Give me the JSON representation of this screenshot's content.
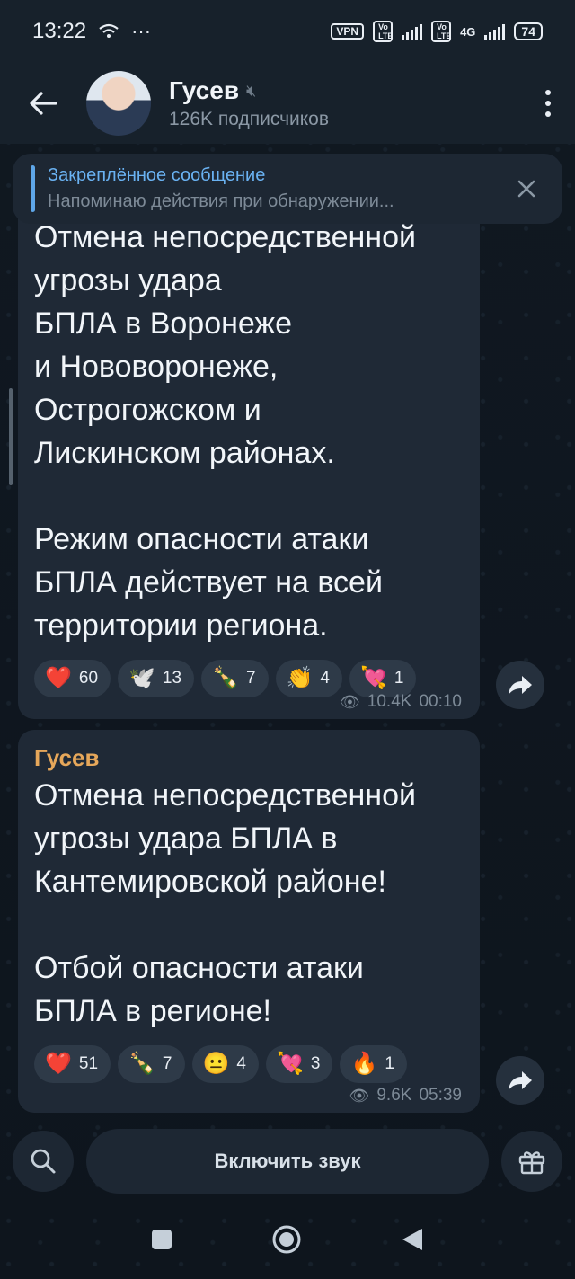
{
  "status": {
    "time": "13:22",
    "vpn": "VPN",
    "volte1": "Vo LTE",
    "volte2": "Vo LTE",
    "net": "4G",
    "battery": "74"
  },
  "header": {
    "title": "Гусев",
    "subtitle": "126K подписчиков"
  },
  "pinned": {
    "title": "Закреплённое сообщение",
    "body": "Напоминаю действия при обнаружении..."
  },
  "messages": [
    {
      "text": "Отмена непосредственной\nугрозы удара\nБПЛА в Воронеже\nи Нововоронеже,\nОстрогожском и\nЛискинском районах.\n\nРежим опасности атаки\nБПЛА действует на всей\nтерритории региона.",
      "reactions": [
        {
          "emoji": "❤️",
          "count": "60"
        },
        {
          "emoji": "🕊️",
          "count": "13"
        },
        {
          "emoji": "🍾",
          "count": "7"
        },
        {
          "emoji": "👏",
          "count": "4"
        },
        {
          "emoji": "💘",
          "count": "1"
        }
      ],
      "views": "10.4K",
      "time": "00:10"
    },
    {
      "author": "Гусев",
      "text": "Отмена непосредственной\nугрозы удара БПЛА в\nКантемировской районе!\n\nОтбой опасности атаки\nБПЛА в регионе!",
      "reactions": [
        {
          "emoji": "❤️",
          "count": "51"
        },
        {
          "emoji": "🍾",
          "count": "7"
        },
        {
          "emoji": "😐",
          "count": "4"
        },
        {
          "emoji": "💘",
          "count": "3"
        },
        {
          "emoji": "🔥",
          "count": "1"
        }
      ],
      "views": "9.6K",
      "time": "05:39"
    }
  ],
  "bottom": {
    "unmute_label": "Включить звук"
  },
  "icons": {
    "back": "arrow-left-icon",
    "menu": "more-vertical-icon",
    "search": "search-icon",
    "gift": "gift-icon",
    "share": "share-icon"
  },
  "colors": {
    "accent": "#6ab2f2",
    "author": "#e6a75a",
    "bubble": "#1f2936"
  }
}
